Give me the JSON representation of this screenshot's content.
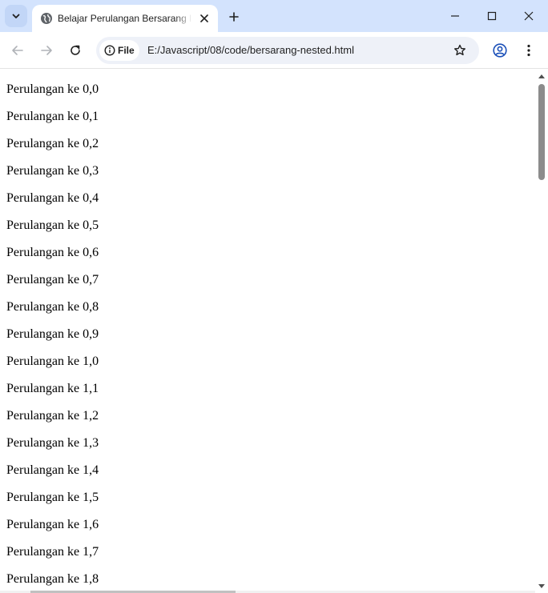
{
  "tab": {
    "title": "Belajar Perulangan Bersarang Nested"
  },
  "omnibox": {
    "chip_label": "File",
    "url": "E:/Javascript/08/code/bersarang-nested.html"
  },
  "icons": {
    "tab_search": "chevron-down-icon",
    "favicon": "globe-icon",
    "tab_close": "close-icon",
    "new_tab": "plus-icon",
    "minimize": "minimize-icon",
    "maximize": "maximize-icon",
    "window_close": "close-icon",
    "back": "arrow-left-icon",
    "forward": "arrow-right-icon",
    "reload": "reload-icon",
    "site_info": "info-icon",
    "bookmark": "star-icon",
    "profile": "profile-icon",
    "menu": "kebab-menu-icon"
  },
  "colors": {
    "tabstrip_bg": "#d3e3fd",
    "omnibox_bg": "#eef1f8",
    "scroll_thumb": "#8c8c8c"
  },
  "page": {
    "lines": [
      "Perulangan ke 0,0",
      "Perulangan ke 0,1",
      "Perulangan ke 0,2",
      "Perulangan ke 0,3",
      "Perulangan ke 0,4",
      "Perulangan ke 0,5",
      "Perulangan ke 0,6",
      "Perulangan ke 0,7",
      "Perulangan ke 0,8",
      "Perulangan ke 0,9",
      "Perulangan ke 1,0",
      "Perulangan ke 1,1",
      "Perulangan ke 1,2",
      "Perulangan ke 1,3",
      "Perulangan ke 1,4",
      "Perulangan ke 1,5",
      "Perulangan ke 1,6",
      "Perulangan ke 1,7",
      "Perulangan ke 1,8"
    ]
  }
}
